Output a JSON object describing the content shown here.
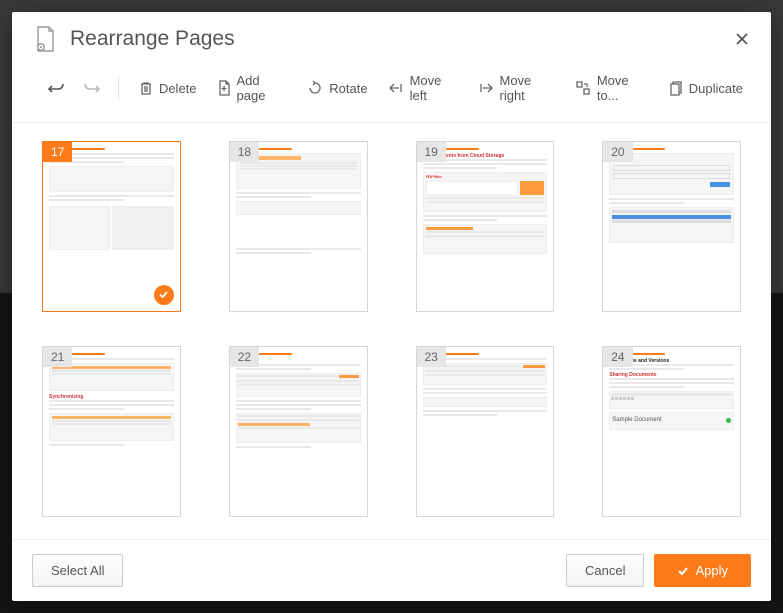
{
  "header": {
    "title": "Rearrange Pages"
  },
  "toolbar": {
    "delete": "Delete",
    "add_page": "Add page",
    "rotate": "Rotate",
    "move_left": "Move left",
    "move_right": "Move right",
    "move_to": "Move to...",
    "duplicate": "Duplicate"
  },
  "pages": [
    {
      "num": "17",
      "selected": true
    },
    {
      "num": "18",
      "selected": false
    },
    {
      "num": "19",
      "selected": false
    },
    {
      "num": "20",
      "selected": false
    },
    {
      "num": "21",
      "selected": false
    },
    {
      "num": "22",
      "selected": false
    },
    {
      "num": "23",
      "selected": false
    },
    {
      "num": "24",
      "selected": false
    }
  ],
  "preview_text": {
    "19_title": "… Documents from Cloud Storage",
    "19_brand": "PDFfiller",
    "21_title": "Synchronizing",
    "24_title": "Collaborate and Versions",
    "24_sub": "…",
    "24_heading": "Sharing Documents",
    "24_sample": "Sample Document"
  },
  "footer": {
    "select_all": "Select All",
    "cancel": "Cancel",
    "apply": "Apply"
  }
}
